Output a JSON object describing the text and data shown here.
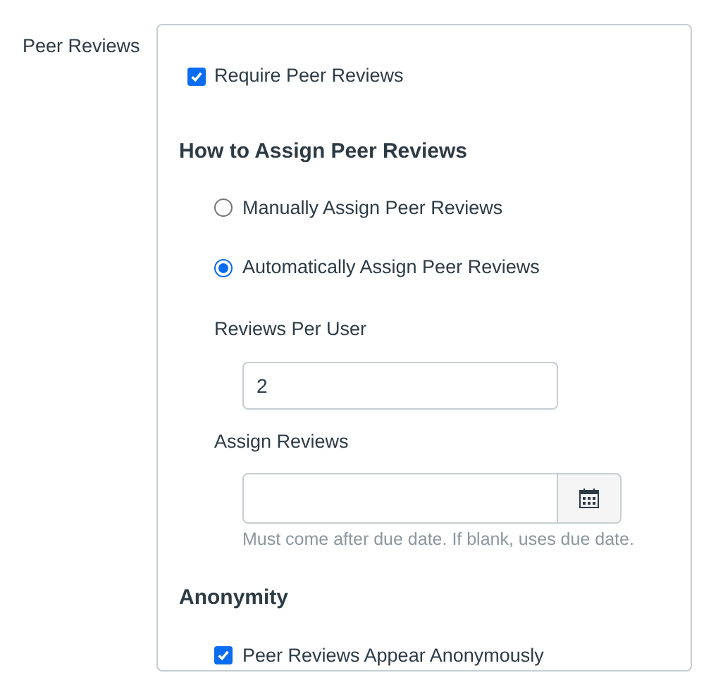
{
  "section_label": "Peer Reviews",
  "require": {
    "label": "Require Peer Reviews",
    "checked": true
  },
  "assign_heading": "How to Assign Peer Reviews",
  "assign_options": [
    {
      "label": "Manually Assign Peer Reviews",
      "selected": false
    },
    {
      "label": "Automatically Assign Peer Reviews",
      "selected": true
    }
  ],
  "reviews_per_user": {
    "label": "Reviews Per User",
    "value": "2"
  },
  "assign_reviews": {
    "label": "Assign Reviews",
    "hint": "Must come after due date. If blank, uses due date."
  },
  "anonymity_heading": "Anonymity",
  "anonymous": {
    "label": "Peer Reviews Appear Anonymously",
    "checked": true
  }
}
